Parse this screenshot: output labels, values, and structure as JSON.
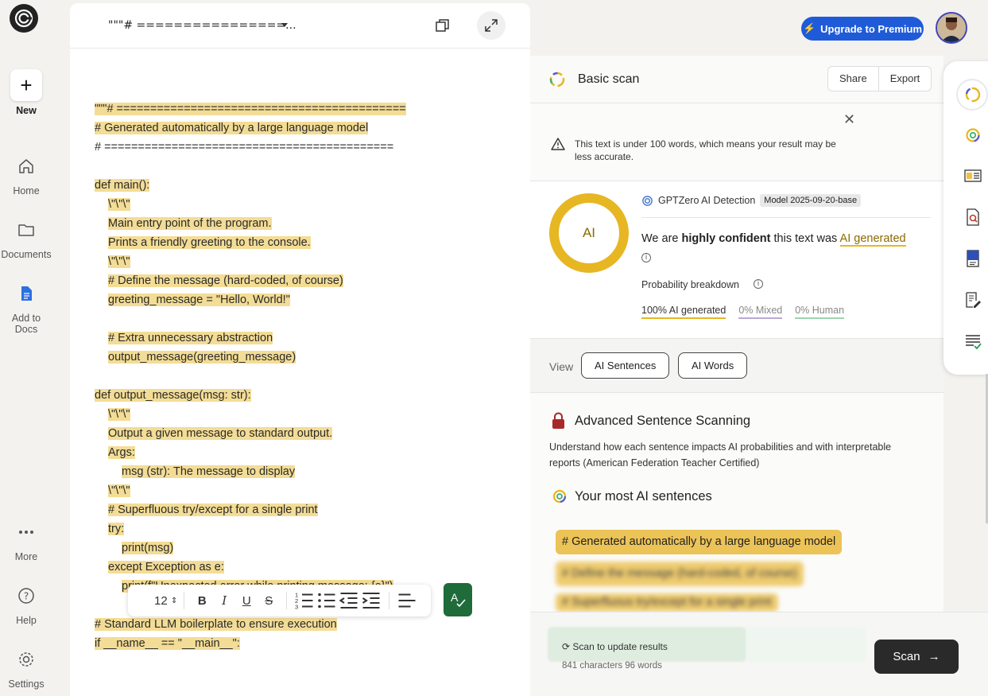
{
  "sidebar": {
    "new_label": "New",
    "items": [
      {
        "label": "Home",
        "icon": "home-icon"
      },
      {
        "label": "Documents",
        "icon": "folder-icon"
      },
      {
        "label": "Add to Docs",
        "icon": "doc-icon"
      }
    ],
    "bottom": [
      {
        "label": "More",
        "icon": "more-icon"
      },
      {
        "label": "Help",
        "icon": "help-icon"
      },
      {
        "label": "Settings",
        "icon": "gear-icon"
      }
    ]
  },
  "editor": {
    "title": "\"\"\"# ================...",
    "lines": [
      "\"\"\"# ===========================================",
      "# Generated automatically by a large language model",
      "# ===========================================",
      "",
      "def main():",
      "\\\"\\\"\\\"",
      "Main entry point of the program.",
      "Prints a friendly greeting to the console.",
      "\\\"\\\"\\\"",
      "# Define the message (hard-coded, of course)",
      "greeting_message = \"Hello, World!\"",
      "",
      "# Extra unnecessary abstraction",
      "output_message(greeting_message)",
      "",
      "def output_message(msg: str):",
      "\\\"\\\"\\\"",
      "Output a given message to standard output.",
      "Args:",
      "msg (str): The message to display",
      "\\\"\\\"\\\"",
      "# Superfluous try/except for a single print",
      "try:",
      "print(msg)",
      "except Exception as e:",
      "print(f\"Unexpected error while printing message: {e}\")",
      "",
      "# Standard LLM boilerplate to ensure execution",
      "if __name__ == \"__main__\":"
    ],
    "toolbar": {
      "font_size": "12"
    }
  },
  "topbar": {
    "upgrade_label": "Upgrade to Premium"
  },
  "scan": {
    "title": "Basic scan",
    "share_label": "Share",
    "export_label": "Export",
    "warning": "This text is under 100 words, which means your result may be less accurate.",
    "donut_label": "AI",
    "detector_name": "GPTZero AI Detection",
    "model_badge": "Model 2025-09-20-base",
    "confidence_prefix": "We are ",
    "confidence_bold": "highly confident",
    "confidence_mid": " this text was ",
    "confidence_result": "AI generated",
    "prob_label": "Probability breakdown",
    "prob_ai": "100% AI generated",
    "prob_mixed": "0% Mixed",
    "prob_human": "0% Human",
    "view_label": "View",
    "view_ai_sentences": "AI Sentences",
    "view_ai_words": "AI Words",
    "adv_title": "Advanced Sentence Scanning",
    "adv_text": "Understand how each sentence impacts AI probabilities and with interpretable reports (American Federation Teacher Certified)",
    "most_title": "Your most AI sentences",
    "sentences": [
      "# Generated automatically by a large language model",
      "# Define the message (hard-coded, of course)",
      "# Superfluous try/except for a single print"
    ],
    "update_text": "Scan to update results",
    "char_count": "841 characters 96 words",
    "scan_button": "Scan"
  },
  "colors": {
    "ai_yellow": "#e7b623",
    "highlight": "#f3dc95",
    "upgrade_blue": "#1f5bd8",
    "spell_green": "#1f6b3a"
  }
}
